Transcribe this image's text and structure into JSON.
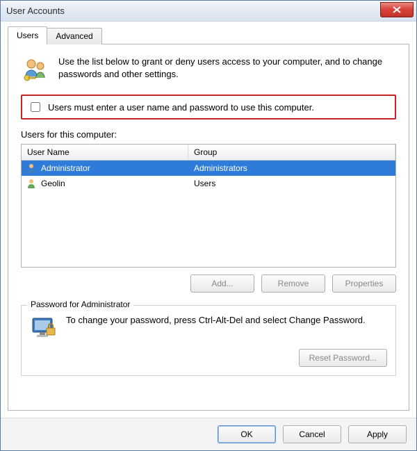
{
  "window": {
    "title": "User Accounts"
  },
  "tabs": [
    {
      "label": "Users",
      "active": true
    },
    {
      "label": "Advanced",
      "active": false
    }
  ],
  "intro": {
    "text": "Use the list below to grant or deny users access to your computer, and to change passwords and other settings."
  },
  "checkbox": {
    "label": "Users must enter a user name and password to use this computer.",
    "checked": false
  },
  "list": {
    "caption": "Users for this computer:",
    "columns": [
      "User Name",
      "Group"
    ],
    "rows": [
      {
        "name": "Administrator",
        "group": "Administrators",
        "selected": true
      },
      {
        "name": "Geolin",
        "group": "Users",
        "selected": false
      }
    ]
  },
  "row_buttons": {
    "add": "Add...",
    "remove": "Remove",
    "properties": "Properties"
  },
  "password_group": {
    "legend": "Password for Administrator",
    "text": "To change your password, press Ctrl-Alt-Del and select Change Password.",
    "reset": "Reset Password..."
  },
  "footer": {
    "ok": "OK",
    "cancel": "Cancel",
    "apply": "Apply"
  }
}
